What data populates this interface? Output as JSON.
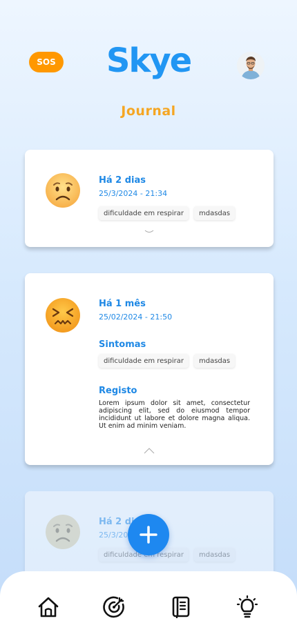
{
  "header": {
    "sos_label": "SOS",
    "logo_text": "Skye",
    "avatar_icon": "user-avatar"
  },
  "page": {
    "title": "Journal"
  },
  "entries": [
    {
      "relative_time": "Há 2 dias",
      "datetime": "25/3/2024 - 21:34",
      "mood_icon": "worried-face",
      "tags": [
        "dificuldade em respirar",
        "mdasdas"
      ],
      "expanded": false
    },
    {
      "relative_time": "Há 1 mês",
      "datetime": "25/02/2024 - 21:50",
      "mood_icon": "confounded-face",
      "symptoms_label": "Sintomas",
      "tags": [
        "dificuldade em respirar",
        "mdasdas"
      ],
      "record_label": "Registo",
      "record_text": "Lorem ipsum dolor sit amet, consectetur adipiscing elit, sed do eiusmod tempor incididunt ut labore et dolore magna aliqua. Ut enim ad minim veniam.",
      "expanded": true
    },
    {
      "relative_time": "Há 2 dias",
      "datetime": "25/3/2024 - 21:34",
      "mood_icon": "worried-face",
      "tags": [
        "dificuldade em respirar",
        "mdasdas"
      ],
      "expanded": false
    }
  ],
  "fab": {
    "icon": "plus-icon"
  },
  "nav": {
    "items": [
      {
        "icon": "home-icon"
      },
      {
        "icon": "target-icon"
      },
      {
        "icon": "journal-icon"
      },
      {
        "icon": "lightbulb-icon"
      }
    ]
  },
  "colors": {
    "accent": "#1e88e5",
    "sos": "#ff9800",
    "title": "#f5a623"
  }
}
